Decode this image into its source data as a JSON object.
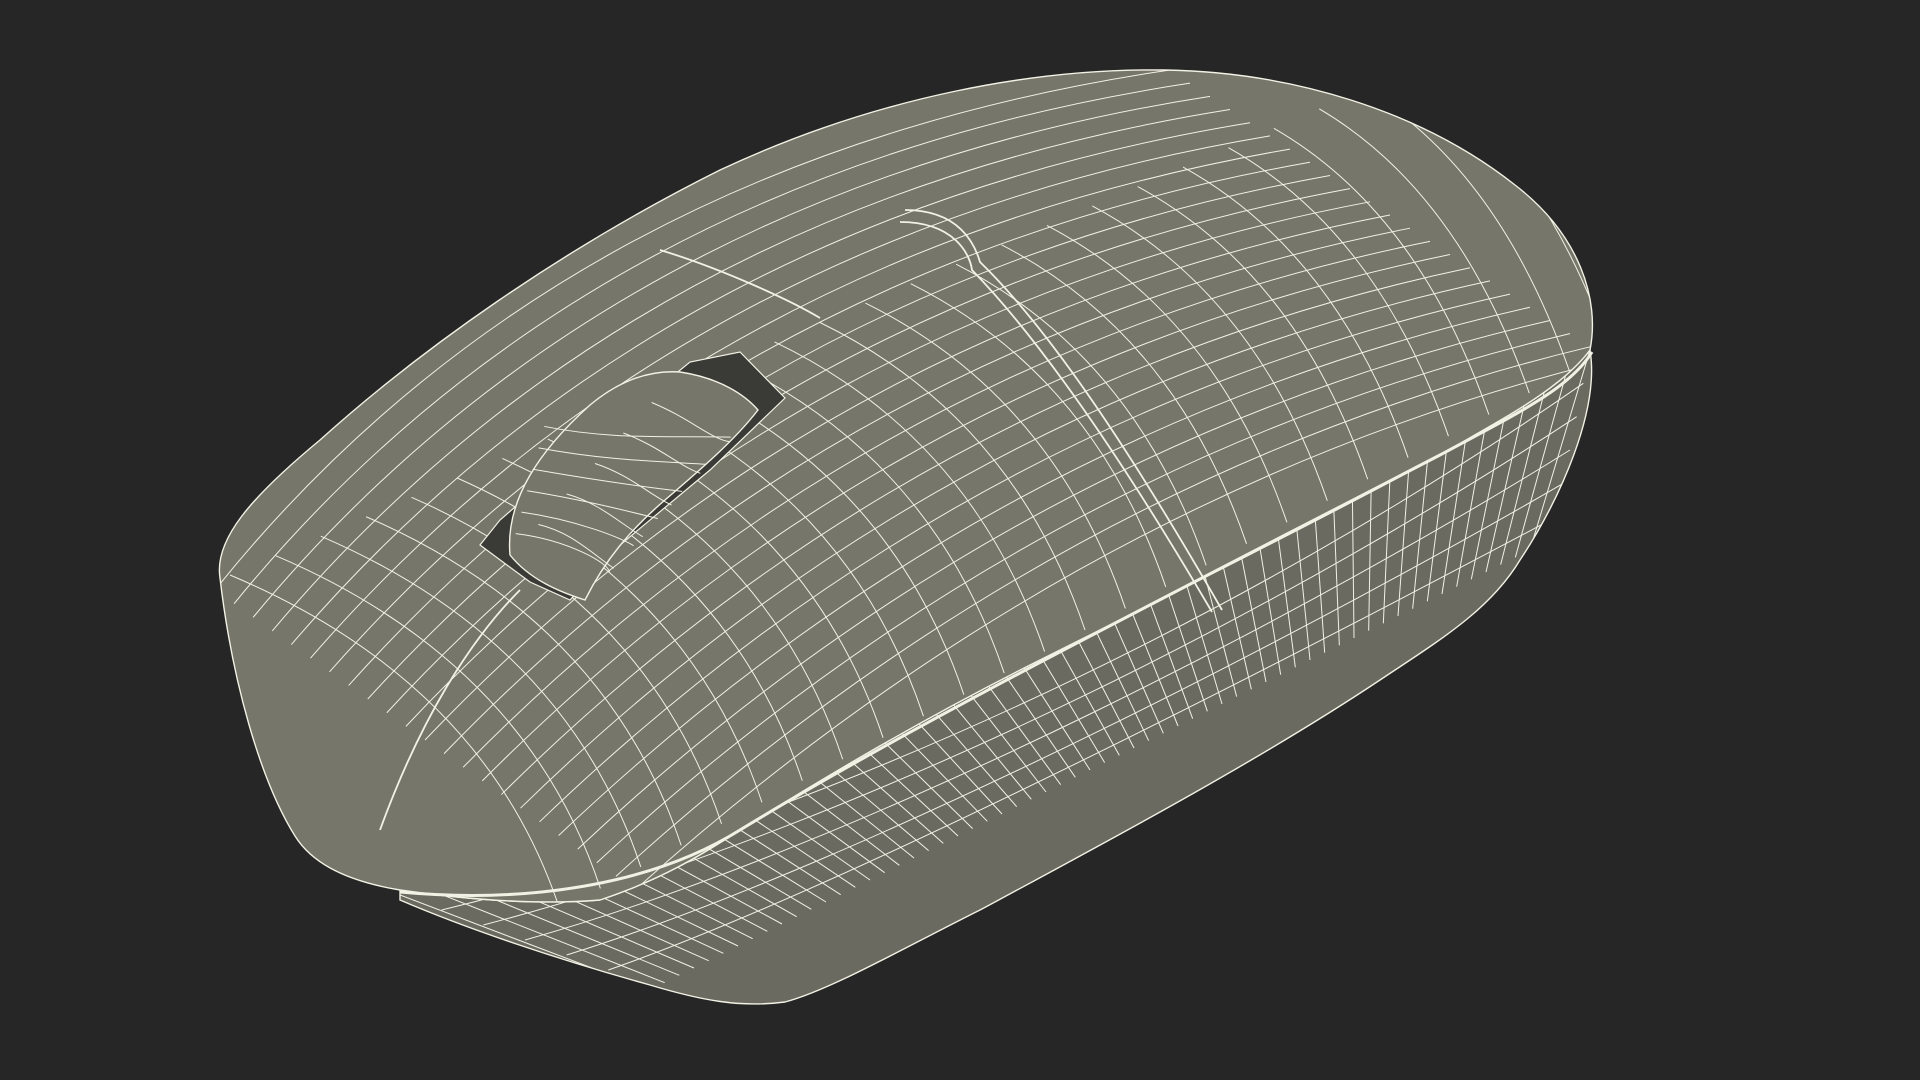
{
  "scene": {
    "subject": "computer-mouse-wireframe",
    "colors": {
      "background": "#262626",
      "surface": "#76766b",
      "surface_dark": "#6a6a60",
      "wire": "#f1f1e4",
      "cavity": "#3a3a36"
    }
  }
}
